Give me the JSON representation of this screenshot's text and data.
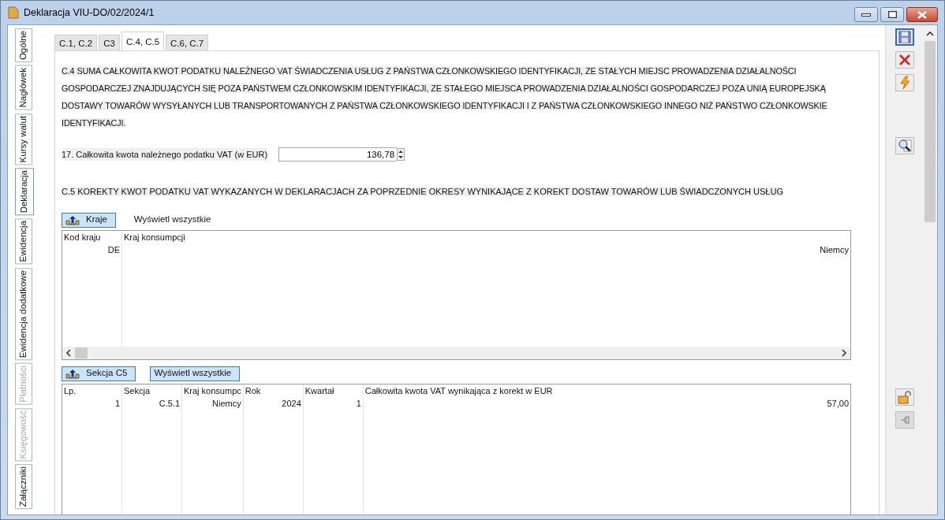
{
  "window": {
    "title": "Deklaracja VIU-DO/02/2024/1"
  },
  "side_tabs": [
    {
      "label": "Ogólne",
      "selected": false,
      "disabled": false
    },
    {
      "label": "Nagłówek",
      "selected": false,
      "disabled": false
    },
    {
      "label": "Kursy walut",
      "selected": false,
      "disabled": false
    },
    {
      "label": "Deklaracja",
      "selected": true,
      "disabled": false
    },
    {
      "label": "Ewidencja",
      "selected": false,
      "disabled": false
    },
    {
      "label": "Ewidencja dodatkowe",
      "selected": false,
      "disabled": false
    },
    {
      "label": "Płatności",
      "selected": false,
      "disabled": true
    },
    {
      "label": "Księgowość",
      "selected": false,
      "disabled": true
    },
    {
      "label": "Załączniki",
      "selected": false,
      "disabled": false
    }
  ],
  "tabs": [
    {
      "label": "C.1, C.2",
      "selected": false
    },
    {
      "label": "C3",
      "selected": false
    },
    {
      "label": "C.4, C.5",
      "selected": true
    },
    {
      "label": "C.6, C.7",
      "selected": false
    }
  ],
  "section_c4": {
    "text": "C.4 SUMA CAŁKOWITA KWOT PODATKU NALEŻNEGO VAT ŚWIADCZENIA USŁUG Z PAŃSTWA CZŁONKOWSKIEGO IDENTYFIKACJI, ZE STAŁYCH MIEJSC PROWADZENIA DZIAŁALNOŚCI GOSPODARCZEJ ZNAJDUJĄCYCH SIĘ POZA PAŃSTWEM CZŁONKOWSKIM IDENTYFIKACJI, ZE STAŁEGO MIEJSCA PROWADZENIA DZIAŁALNOŚCI GOSPODARCZEJ POZA UNIĄ EUROPEJSKĄ DOSTAWY TOWARÓW WYSYŁANYCH LUB TRANSPORTOWANYCH Z PAŃSTWA CZŁONKOWSKIEGO IDENTYFIKACJI I Z PAŃSTWA CZŁONKOWSKIEGO INNEGO NIŻ PAŃSTWO CZŁONKOWSKIE IDENTYFIKACJI.",
    "field_label": "17. Całkowita kwota należnego podatku VAT (w EUR)",
    "field_value": "136,78"
  },
  "section_c5": {
    "text": "C.5 KOREKTY KWOT PODATKU VAT WYKAZANYCH W DEKLARACJACH ZA POPRZEDNIE OKRESY WYNIKAJĄCE Z KOREKT DOSTAW TOWARÓW LUB ŚWIADCZONYCH USŁUG"
  },
  "countries": {
    "buttons": [
      {
        "label": "Kraje",
        "kind": "upload",
        "pressed": true
      },
      {
        "label": "Wyświetl wszystkie",
        "kind": "text",
        "pressed": false
      }
    ],
    "columns": [
      "Kod kraju",
      "Kraj konsumpcji"
    ],
    "rows": [
      [
        "DE",
        "Niemcy"
      ]
    ]
  },
  "corrections": {
    "buttons": [
      {
        "label": "Sekcja C5",
        "kind": "upload",
        "pressed": true
      },
      {
        "label": "Wyświetl wszystkie",
        "kind": "text",
        "pressed": true
      }
    ],
    "columns": [
      "Lp.",
      "Sekcja",
      "Kraj konsumpc",
      "Rok",
      "Kwartał",
      "Całkowita kwota VAT wynikająca z korekt w EUR"
    ],
    "rows": [
      [
        "1",
        "C.5.1",
        "Niemcy",
        "2024",
        "1",
        "57,00"
      ]
    ]
  }
}
